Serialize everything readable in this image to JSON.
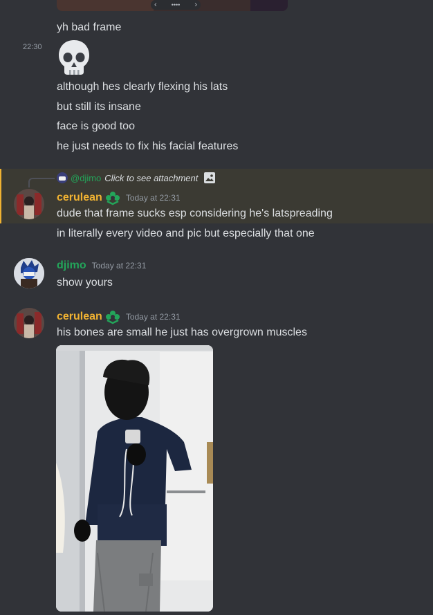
{
  "top_attachment": {
    "nav_dots": "••••",
    "nav_prev": "‹",
    "nav_next": "›"
  },
  "messages": {
    "m1": {
      "text": "yh bad frame"
    },
    "m2": {
      "timestamp": "22:30",
      "emoji": "skull"
    },
    "m3": {
      "text": "although hes clearly flexing his lats"
    },
    "m4": {
      "text": "but still its insane"
    },
    "m5": {
      "text": "face is good too"
    },
    "m6": {
      "text": "he just needs to fix his facial features"
    }
  },
  "reply_message": {
    "reply_to": "@djimo",
    "reply_preview": "Click to see attachment",
    "author": "cerulean",
    "author_color": "#f0b232",
    "timestamp": "Today at 22:31",
    "line1": "dude that frame sucks esp considering he's latspreading",
    "line2": "in literally every video and pic but especially that one"
  },
  "djimo_message": {
    "author": "djimo",
    "author_color": "#23a55a",
    "timestamp": "Today at 22:31",
    "text": "show yours"
  },
  "cerulean_message": {
    "author": "cerulean",
    "author_color": "#f0b232",
    "timestamp": "Today at 22:31",
    "text": "his bones are small he just has overgrown muscles"
  },
  "colors": {
    "background": "#313338",
    "highlight": "#3b3a33",
    "highlight_border": "#f0b232",
    "text": "#dbdee1",
    "muted": "#949ba4"
  }
}
